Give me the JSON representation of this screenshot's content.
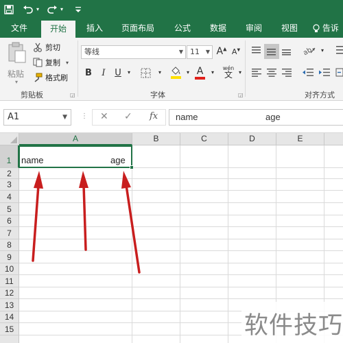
{
  "quick_access": {
    "save_icon": "save-icon",
    "undo_icon": "undo-icon",
    "redo_icon": "redo-icon",
    "customize_icon": "customize-qat-icon"
  },
  "ribbon_tabs": {
    "file": "文件",
    "home": "开始",
    "insert": "插入",
    "page_layout": "页面布局",
    "formulas": "公式",
    "data": "数据",
    "review": "审阅",
    "view": "视图",
    "tell_me": "告诉"
  },
  "clipboard": {
    "paste": "粘贴",
    "cut": "剪切",
    "copy": "复制",
    "format_painter": "格式刷",
    "group_label": "剪贴板"
  },
  "font": {
    "font_name": "等线",
    "font_size": "11",
    "grow": "A",
    "shrink": "A",
    "bold": "B",
    "italic": "I",
    "underline": "U",
    "font_color": "A",
    "phonetic": "wén",
    "group_label": "字体"
  },
  "alignment": {
    "group_label": "对齐方式"
  },
  "formula_bar": {
    "name_box": "A1",
    "cancel": "✕",
    "enter": "✓",
    "fx": "fx",
    "content_part1": "name",
    "content_part2": "age"
  },
  "sheet": {
    "columns": [
      "A",
      "B",
      "C",
      "D",
      "E"
    ],
    "rows": [
      "1",
      "2",
      "3",
      "4",
      "5",
      "6",
      "7",
      "8",
      "9",
      "10",
      "11",
      "12",
      "13",
      "14",
      "15"
    ],
    "a1_left": "name",
    "a1_right": "age"
  },
  "watermark": "软件技巧",
  "colors": {
    "excel_green": "#217346",
    "arrow_red": "#c81e1e",
    "highlight_yellow": "#ffe000",
    "font_red": "#e0201b"
  }
}
